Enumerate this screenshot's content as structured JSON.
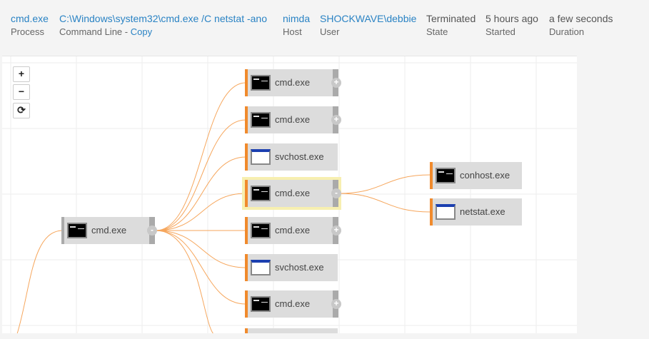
{
  "header": {
    "process": {
      "value": "cmd.exe",
      "label": "Process"
    },
    "command_line": {
      "value": "C:\\Windows\\system32\\cmd.exe /C netstat -ano",
      "label": "Command Line - ",
      "copy": "Copy"
    },
    "host": {
      "value": "nimda",
      "label": "Host"
    },
    "user": {
      "value": "SHOCKWAVE\\debbie",
      "label": "User"
    },
    "state": {
      "value": "Terminated",
      "label": "State"
    },
    "started": {
      "value": "5 hours ago",
      "label": "Started"
    },
    "duration": {
      "value": "a few seconds",
      "label": "Duration"
    }
  },
  "zoom": {
    "in": "+",
    "out": "−",
    "reset": "⟳"
  },
  "graph": {
    "root": {
      "label": "cmd.exe",
      "icon": "cmd-icon",
      "toggle": "-"
    },
    "children": [
      {
        "label": "cmd.exe",
        "icon": "cmd-icon",
        "toggle": "+"
      },
      {
        "label": "cmd.exe",
        "icon": "cmd-icon",
        "toggle": "+"
      },
      {
        "label": "svchost.exe",
        "icon": "window-icon",
        "toggle": ""
      },
      {
        "label": "cmd.exe",
        "icon": "cmd-icon",
        "toggle": "-",
        "selected": true
      },
      {
        "label": "cmd.exe",
        "icon": "cmd-icon",
        "toggle": "+"
      },
      {
        "label": "svchost.exe",
        "icon": "window-icon",
        "toggle": ""
      },
      {
        "label": "cmd.exe",
        "icon": "cmd-icon",
        "toggle": "+"
      }
    ],
    "grandchildren": [
      {
        "label": "conhost.exe",
        "icon": "cmd-icon"
      },
      {
        "label": "netstat.exe",
        "icon": "window-icon"
      }
    ]
  },
  "colors": {
    "accent": "#f08a2c",
    "link": "#2a83c4",
    "selected": "#f7efb0"
  }
}
